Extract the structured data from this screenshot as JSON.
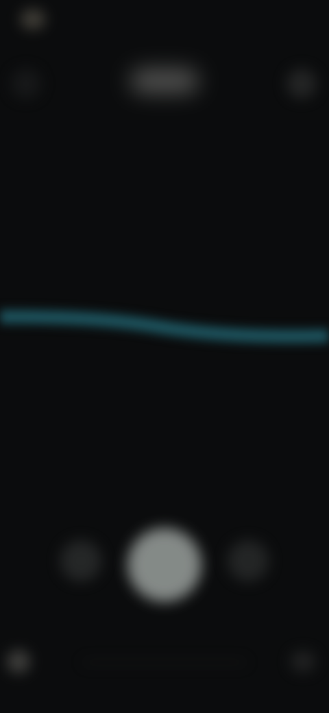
{
  "app": {
    "name": "",
    "accent_color": "#1f5a66",
    "background_color": "#0b0c0d"
  },
  "status_bar": {
    "time": ""
  },
  "header": {
    "title": "",
    "back_icon": "back-icon",
    "menu_icon": "more-icon"
  },
  "waveform": {
    "color": "#1c4e58"
  },
  "controls": {
    "left_icon": "control-left-icon",
    "center_icon": "record-icon",
    "right_icon": "control-right-icon"
  },
  "bottom_bar": {
    "left_icon": "bottom-left-icon",
    "right_icon": "bottom-right-icon"
  }
}
